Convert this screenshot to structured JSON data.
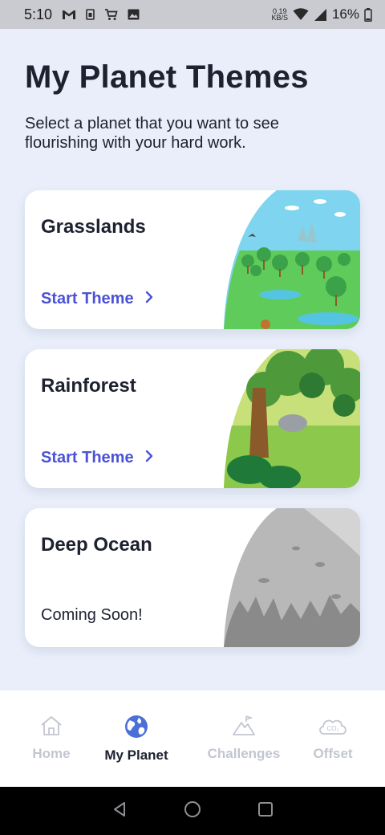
{
  "status_bar": {
    "time": "5:10",
    "net_speed_value": "0.19",
    "net_speed_unit": "KB/S",
    "battery": "16%",
    "icons": [
      "gmail-icon",
      "sim-icon",
      "cart-icon",
      "image-icon",
      "wifi-icon",
      "signal-icon",
      "battery-icon"
    ]
  },
  "header": {
    "title": "My Planet Themes",
    "subtitle": "Select a planet that you want to see flourishing with your hard work."
  },
  "themes": [
    {
      "name": "Grasslands",
      "action": "Start Theme",
      "available": true,
      "art": "grasslands-illustration"
    },
    {
      "name": "Rainforest",
      "action": "Start Theme",
      "available": true,
      "art": "rainforest-illustration"
    },
    {
      "name": "Deep Ocean",
      "status": "Coming Soon!",
      "available": false,
      "art": "deep-ocean-illustration"
    }
  ],
  "bottom_nav": {
    "active": "My Planet",
    "items": [
      {
        "label": "Home",
        "icon": "home-icon"
      },
      {
        "label": "My Planet",
        "icon": "globe-icon"
      },
      {
        "label": "Challenges",
        "icon": "mountain-icon"
      },
      {
        "label": "Offset",
        "icon": "co2-cloud-icon"
      }
    ]
  },
  "colors": {
    "background": "#e9eefa",
    "accent": "#4a52d6",
    "text": "#1d2130",
    "nav_inactive": "#c3c6d0"
  }
}
